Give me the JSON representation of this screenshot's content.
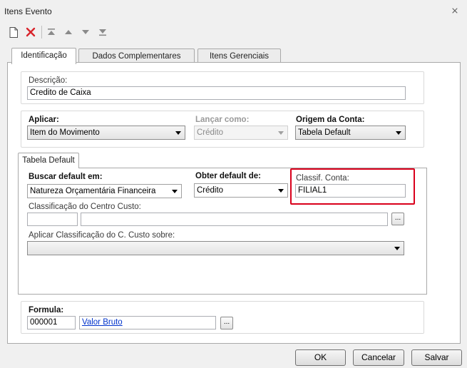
{
  "window": {
    "title": "Itens Evento"
  },
  "tabs": [
    {
      "label": "Identificação"
    },
    {
      "label": "Dados Complementares"
    },
    {
      "label": "Itens Gerenciais"
    }
  ],
  "descricao": {
    "label": "Descrição:",
    "value": "Credito de Caixa"
  },
  "aplicar": {
    "label": "Aplicar:",
    "value": "Item do Movimento"
  },
  "lancar_como": {
    "label": "Lançar como:",
    "value": "Crédito"
  },
  "origem_conta": {
    "label": "Origem da Conta:",
    "value": "Tabela Default"
  },
  "inner_tab": {
    "label": "Tabela Default"
  },
  "buscar_default": {
    "label": "Buscar default em:",
    "value": "Natureza Orçamentária Financeira"
  },
  "obter_default": {
    "label": "Obter default de:",
    "value": "Crédito"
  },
  "classif_conta": {
    "label": "Classif. Conta:",
    "value": "FILIAL1"
  },
  "classif_centro_custo": {
    "label": "Classificação do Centro Custo:",
    "button": "..."
  },
  "aplicar_classif": {
    "label": "Aplicar Classificação do C. Custo sobre:",
    "value": ""
  },
  "formula": {
    "label": "Formula:",
    "code": "000001",
    "link": "Valor Bruto",
    "button": "..."
  },
  "buttons": {
    "ok": "OK",
    "cancel": "Cancelar",
    "save": "Salvar"
  },
  "close_glyph": "⨯",
  "colors": {
    "highlight": "#d9001b",
    "link": "#0033cc"
  }
}
